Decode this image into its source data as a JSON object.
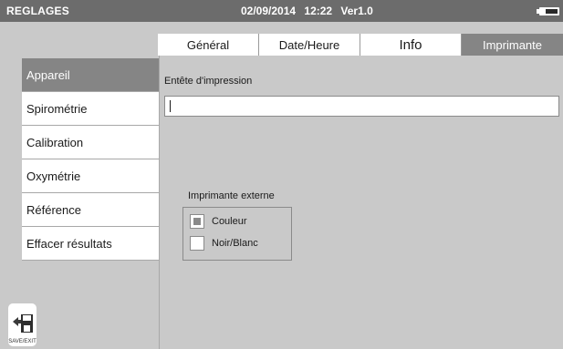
{
  "header": {
    "title": "REGLAGES",
    "datetime": "02/09/2014 12:22 Ver1.0",
    "battery_icon": "battery-icon"
  },
  "tabs": [
    {
      "label": "Général",
      "active": false
    },
    {
      "label": "Date/Heure",
      "active": false
    },
    {
      "label": "Info",
      "active": false
    },
    {
      "label": "Imprimante",
      "active": true
    }
  ],
  "sidebar": {
    "items": [
      {
        "label": "Appareil",
        "active": true
      },
      {
        "label": "Spirométrie",
        "active": false
      },
      {
        "label": "Calibration",
        "active": false
      },
      {
        "label": "Oxymétrie",
        "active": false
      },
      {
        "label": "Référence",
        "active": false
      },
      {
        "label": "Effacer résultats",
        "active": false
      }
    ]
  },
  "content": {
    "header_field_label": "Entête d'impression",
    "header_field_value": "",
    "printer_group": {
      "title": "Imprimante externe",
      "options": [
        {
          "label": "Couleur",
          "selected": true
        },
        {
          "label": "Noir/Blanc",
          "selected": false
        }
      ]
    }
  },
  "save_exit": {
    "label": "SAVE/EXIT",
    "icon": "save-exit-icon"
  },
  "colors": {
    "titlebar": "#6c6c6c",
    "active": "#858585",
    "background": "#c9c9c9"
  }
}
